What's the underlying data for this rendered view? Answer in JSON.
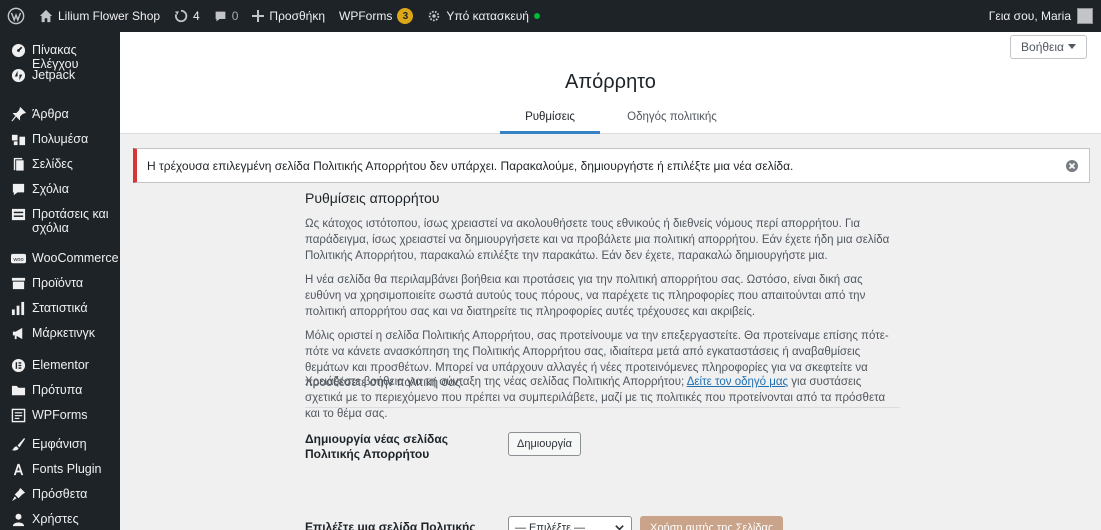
{
  "admin_bar": {
    "site_name": "Lilium Flower Shop",
    "updates_count": "4",
    "comments_count": "0",
    "new_label": "Προσθήκη",
    "wpforms_label": "WPForms",
    "wpforms_badge": "3",
    "maintenance_label": "Υπό κατασκευή",
    "greeting": "Γεια σου, Maria"
  },
  "sidebar": {
    "items": [
      {
        "label": "Πίνακας Ελέγχου",
        "icon": "dashboard-icon"
      },
      {
        "label": "Jetpack",
        "icon": "jetpack-icon"
      },
      {
        "label": "Άρθρα",
        "icon": "pin-icon"
      },
      {
        "label": "Πολυμέσα",
        "icon": "media-icon"
      },
      {
        "label": "Σελίδες",
        "icon": "pages-icon"
      },
      {
        "label": "Σχόλια",
        "icon": "comments-icon"
      },
      {
        "label": "Προτάσεις και σχόλια",
        "icon": "feedback-icon"
      },
      {
        "label": "WooCommerce",
        "icon": "woocommerce-icon"
      },
      {
        "label": "Προϊόντα",
        "icon": "products-icon"
      },
      {
        "label": "Στατιστικά",
        "icon": "stats-icon"
      },
      {
        "label": "Μάρκετινγκ",
        "icon": "megaphone-icon"
      },
      {
        "label": "Elementor",
        "icon": "elementor-icon"
      },
      {
        "label": "Πρότυπα",
        "icon": "folder-icon"
      },
      {
        "label": "WPForms",
        "icon": "wpforms-icon"
      },
      {
        "label": "Εμφάνιση",
        "icon": "brush-icon"
      },
      {
        "label": "Fonts Plugin",
        "icon": "font-icon"
      },
      {
        "label": "Πρόσθετα",
        "icon": "plugins-icon"
      },
      {
        "label": "Χρήστες",
        "icon": "users-icon"
      }
    ]
  },
  "help_tab": {
    "label": "Βοήθεια"
  },
  "page": {
    "title": "Απόρρητο",
    "tabs": [
      {
        "label": "Ρυθμίσεις",
        "active": true
      },
      {
        "label": "Οδηγός πολιτικής",
        "active": false
      }
    ]
  },
  "notice": {
    "text": "Η τρέχουσα επιλεγμένη σελίδα Πολιτικής Απορρήτου δεν υπάρχει. Παρακαλούμε, δημιουργήστε ή επιλέξτε μια νέα σελίδα."
  },
  "settings": {
    "title": "Ρυθμίσεις απορρήτου",
    "para1": "Ως κάτοχος ιστότοπου, ίσως χρειαστεί να ακολουθήσετε τους εθνικούς ή διεθνείς νόμους περί απορρήτου. Για παράδειγμα, ίσως χρειαστεί να δημιουργήσετε και να προβάλετε μια πολιτική απορρήτου. Εάν έχετε ήδη μια σελίδα Πολιτικής Απορρήτου, παρακαλώ επιλέξτε την παρακάτω. Εάν δεν έχετε, παρακαλώ δημιουργήστε μια.",
    "para2": "Η νέα σελίδα θα περιλαμβάνει βοήθεια και προτάσεις για την πολιτική απορρήτου σας. Ωστόσο, είναι δική σας ευθύνη να χρησιμοποιείτε σωστά αυτούς τους πόρους, να παρέχετε τις πληροφορίες που απαιτούνται από την πολιτική απορρήτου σας και να διατηρείτε τις πληροφορίες αυτές τρέχουσες και ακριβείς.",
    "para3": "Μόλις οριστεί η σελίδα Πολιτικής Απορρήτου, σας προτείνουμε να την επεξεργαστείτε. Θα προτείναμε επίσης πότε-πότε να κάνετε ανασκόπηση της Πολιτικής Απορρήτου σας, ιδιαίτερα μετά από εγκαταστάσεις ή αναβαθμίσεις θεμάτων και προσθέτων. Μπορεί να υπάρχουν αλλαγές ή νέες προτεινόμενες πληροφορίες για να σκεφτείτε να προσθέσετε στην πολιτική σας.",
    "para4_before": "Χρειάζεστε βοήθεια για τη σύνταξη της νέας σελίδας Πολιτικής Απορρήτου; ",
    "para4_link": "Δείτε τον οδηγό μας",
    "para4_after": " για συστάσεις σχετικά με το περιεχόμενο που πρέπει να συμπεριλάβετε, μαζί με τις πολιτικές που προτείνονται από τα πρόσθετα και το θέμα σας.",
    "create_label": "Δημιουργία νέας σελίδας Πολιτικής Απορρήτου",
    "create_button": "Δημιουργία",
    "select_label": "Επιλέξτε μια σελίδα Πολιτικής Απορρήτου",
    "select_value": "— Επιλέξτε —",
    "use_page_button": "Χρήση αυτής της Σελίδας"
  }
}
